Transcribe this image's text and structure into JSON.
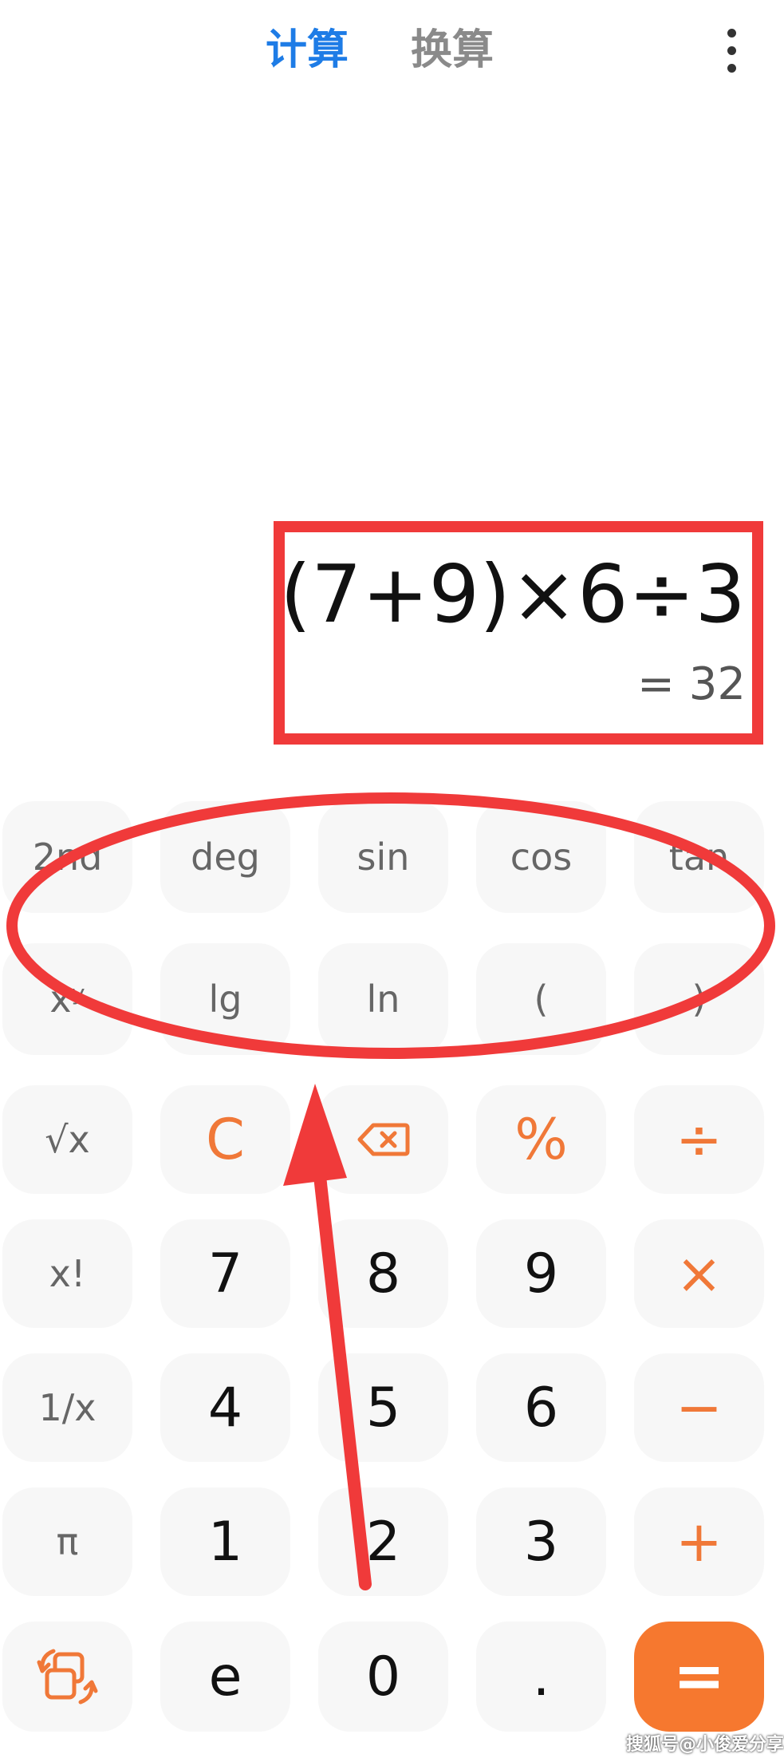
{
  "header": {
    "tabs": [
      {
        "label": "计算",
        "active": true
      },
      {
        "label": "换算",
        "active": false
      }
    ],
    "more_icon": "more-vertical-icon"
  },
  "display": {
    "expression": "(7+9)×6÷3",
    "result": "= 32"
  },
  "keypad": {
    "rows": [
      [
        "2nd",
        "deg",
        "sin",
        "cos",
        "tan"
      ],
      [
        "xʸ",
        "lg",
        "ln",
        "(",
        ")"
      ],
      [
        "√x",
        "C",
        "backspace",
        "%",
        "÷"
      ],
      [
        "x!",
        "7",
        "8",
        "9",
        "×"
      ],
      [
        "1/x",
        "4",
        "5",
        "6",
        "−"
      ],
      [
        "π",
        "1",
        "2",
        "3",
        "+"
      ],
      [
        "switch",
        "e",
        "0",
        ".",
        "="
      ]
    ],
    "backspace_icon": "backspace-icon",
    "switch_icon": "rotate-mode-icon"
  },
  "colors": {
    "tab_active": "#1e7ce6",
    "tab_inactive": "#8a8a8a",
    "operator": "#f07838",
    "equals_bg": "#f6782f",
    "key_bg": "#f7f7f7",
    "annotation": "#f03a3a"
  },
  "watermark": "搜狐号@小俊爱分享"
}
